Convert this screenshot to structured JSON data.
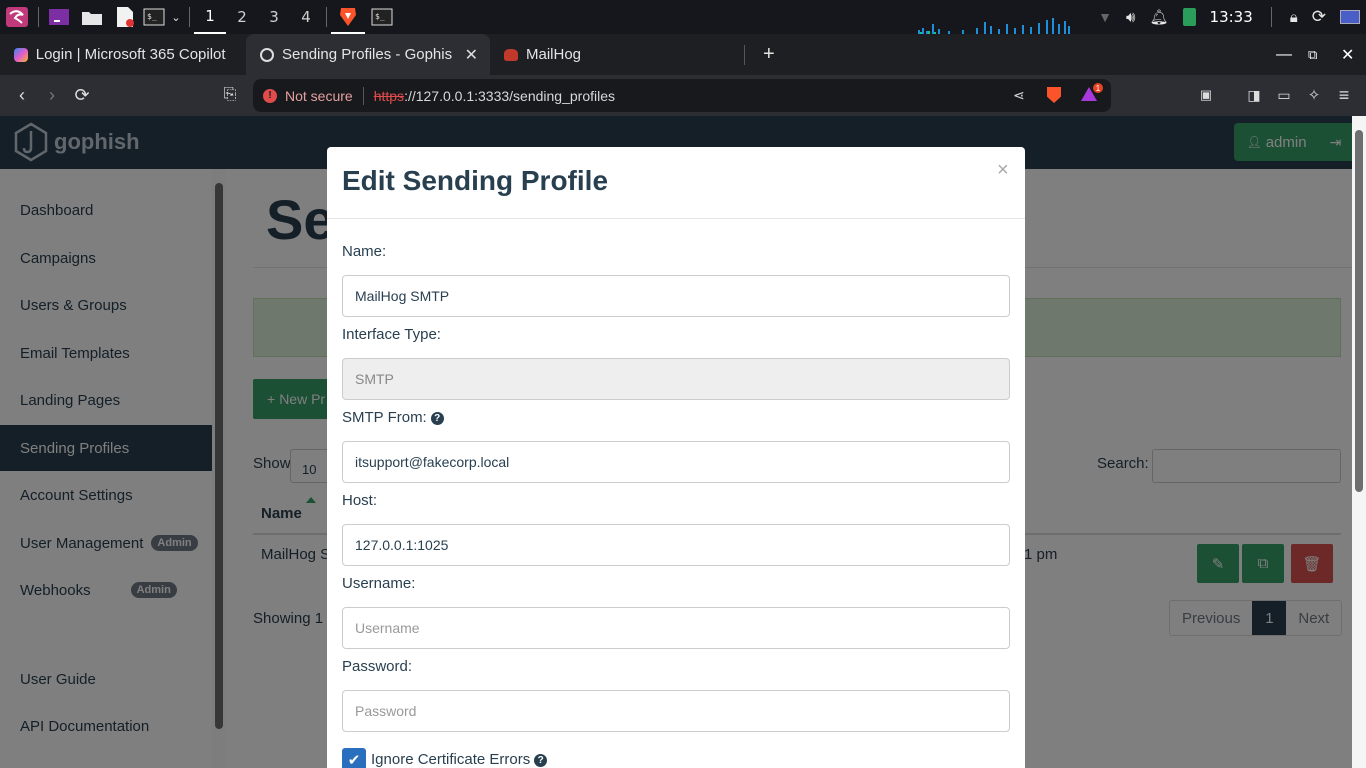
{
  "taskbar": {
    "workspaces": [
      "1",
      "2",
      "3",
      "4"
    ],
    "active_workspace": "1",
    "clock": "13:33"
  },
  "browser": {
    "tabs": [
      {
        "title": "Login | Microsoft 365 Copilot",
        "active": false
      },
      {
        "title": "Sending Profiles - Gophish",
        "active": true
      },
      {
        "title": "MailHog",
        "active": false
      }
    ],
    "security_label": "Not secure",
    "url_scheme": "https",
    "url_rest": "://127.0.0.1:3333/sending_profiles",
    "notification_count": "1"
  },
  "app": {
    "logo_text": "gophish",
    "user_label": "admin",
    "sidebar": [
      {
        "label": "Dashboard"
      },
      {
        "label": "Campaigns"
      },
      {
        "label": "Users & Groups"
      },
      {
        "label": "Email Templates"
      },
      {
        "label": "Landing Pages"
      },
      {
        "label": "Sending Profiles",
        "active": true
      },
      {
        "label": "Account Settings"
      },
      {
        "label": "User Management",
        "badge": "Admin"
      },
      {
        "label": "Webhooks",
        "badge": "Admin"
      },
      {
        "label": "User Guide"
      },
      {
        "label": "API Documentation"
      }
    ],
    "page_title": "Se",
    "new_button": "New Pr",
    "show_label": "Show",
    "show_value": "10",
    "search_label": "Search:",
    "table": {
      "header_name": "Name",
      "row_name": "MailHog S",
      "row_date": "1 pm"
    },
    "showing_text": "Showing 1 t",
    "pagination": {
      "previous": "Previous",
      "current": "1",
      "next": "Next"
    }
  },
  "modal": {
    "title": "Edit Sending Profile",
    "close": "×",
    "fields": {
      "name_label": "Name:",
      "name_value": "MailHog SMTP",
      "interface_label": "Interface Type:",
      "interface_value": "SMTP",
      "from_label": "SMTP From:",
      "from_value": "itsupport@fakecorp.local",
      "host_label": "Host:",
      "host_value": "127.0.0.1:1025",
      "username_label": "Username:",
      "username_placeholder": "Username",
      "password_label": "Password:",
      "password_placeholder": "Password"
    },
    "ignore_cert_label": "Ignore Certificate Errors",
    "ignore_cert_checked": true
  },
  "colors": {
    "navbar": "#283f50",
    "accent_green": "#37a06b",
    "danger": "#d9534f",
    "checkbox_blue": "#2a6fbd"
  }
}
